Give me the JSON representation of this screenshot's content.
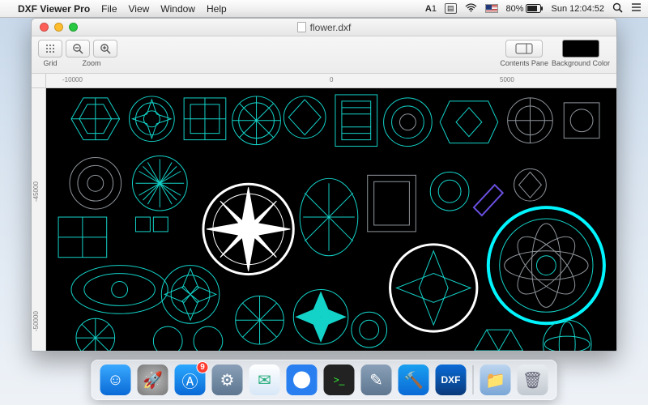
{
  "menubar": {
    "app_name": "DXF Viewer Pro",
    "items": [
      "File",
      "View",
      "Window",
      "Help"
    ],
    "status": {
      "adobe_label": "1",
      "battery_pct": "80%",
      "clock": "Sun 12:04:52",
      "search_icon": "search"
    }
  },
  "window": {
    "title": "flower.dxf",
    "toolbar": {
      "grid_label": "Grid",
      "zoom_label": "Zoom",
      "contents_pane_label": "Contents Pane",
      "background_color_label": "Background Color"
    },
    "ruler_h": {
      "a": "-10000",
      "b": "0",
      "c": "5000"
    },
    "ruler_v": {
      "a": "-45000",
      "b": "-50000"
    },
    "colors": {
      "primary": "#13d3c9",
      "accent_white": "#ffffff",
      "accent_cyan": "#00f5ff",
      "bg": "#000000",
      "purple": "#6a4fe0",
      "gray": "#8f959b"
    }
  },
  "dock": {
    "store_badge": "9",
    "dxf_label": "DXF"
  }
}
